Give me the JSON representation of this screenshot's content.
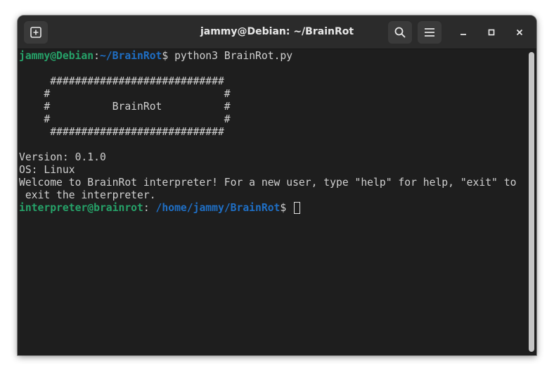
{
  "window": {
    "title": "jammy@Debian: ~/BrainRot",
    "icons": {
      "new_tab": "new-tab-plus-icon",
      "search": "search-icon",
      "menu": "hamburger-menu-icon",
      "minimize": "minimize-icon",
      "maximize": "maximize-icon",
      "close": "close-icon"
    }
  },
  "terminal": {
    "prompt1": {
      "user_host": "jammy@Debian",
      "sep": ":",
      "path": "~/BrainRot",
      "symbol": "$ ",
      "command": "python3 BrainRot.py"
    },
    "banner": [
      "     ############################",
      "    #                            #",
      "    #          BrainRot          #",
      "    #                            #",
      "     ############################"
    ],
    "version_line": "Version: 0.1.0",
    "os_line": "OS: Linux",
    "welcome_line1": "Welcome to BrainRot interpreter! For a new user, type \"help\" for help, \"exit\" to",
    "welcome_line2": " exit the interpreter.",
    "prompt2": {
      "user_host": "interpreter@brainrot",
      "sep": ": ",
      "path": "/home/jammy/BrainRot",
      "symbol": "$ "
    }
  },
  "colors": {
    "prompt_green": "#26a269",
    "prompt_blue": "#1f6fc5",
    "background": "#1e1e1e",
    "titlebar": "#2b2b2b"
  }
}
